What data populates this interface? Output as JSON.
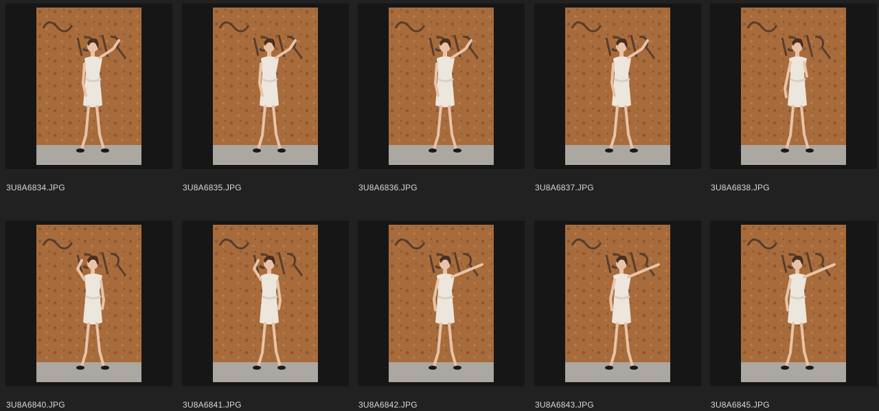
{
  "thumbnails": [
    {
      "filename": "3U8A6834.JPG",
      "pose": "hand-up-left"
    },
    {
      "filename": "3U8A6835.JPG",
      "pose": "hand-up-left"
    },
    {
      "filename": "3U8A6836.JPG",
      "pose": "hand-up-left"
    },
    {
      "filename": "3U8A6837.JPG",
      "pose": "hand-up-left"
    },
    {
      "filename": "3U8A6838.JPG",
      "pose": "standing"
    },
    {
      "filename": "3U8A6840.JPG",
      "pose": "hand-head"
    },
    {
      "filename": "3U8A6841.JPG",
      "pose": "hand-head"
    },
    {
      "filename": "3U8A6842.JPG",
      "pose": "arms-out"
    },
    {
      "filename": "3U8A6843.JPG",
      "pose": "arms-out"
    },
    {
      "filename": "3U8A6845.JPG",
      "pose": "arms-out"
    }
  ],
  "colors": {
    "background": "#212121",
    "tile": "#161616",
    "wall": "#a86c3c",
    "ground": "#aba7a1",
    "dress": "#ece6dc",
    "text": "#d8d8d8"
  }
}
